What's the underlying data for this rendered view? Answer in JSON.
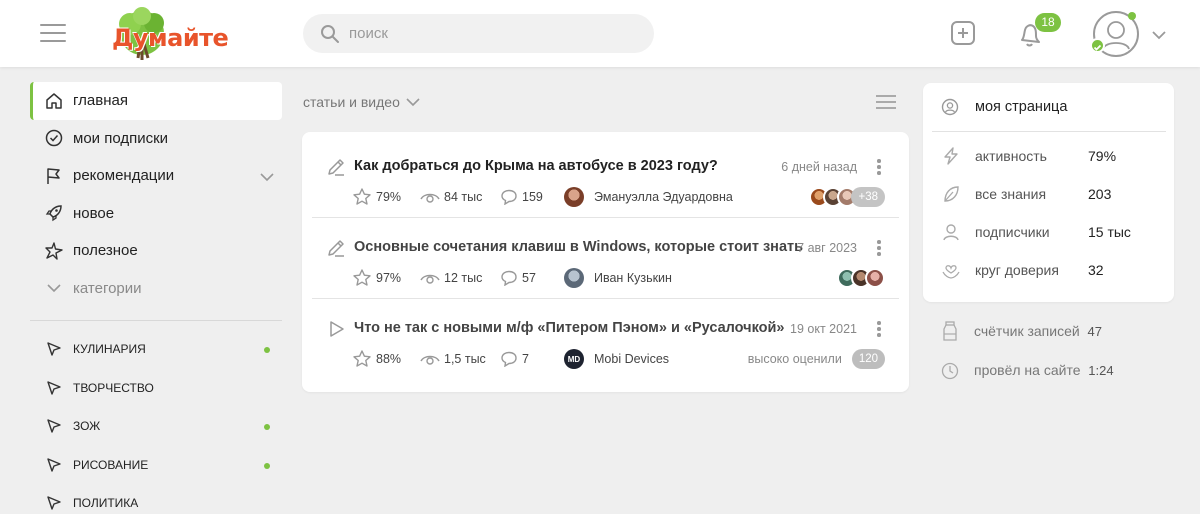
{
  "header": {
    "logo_text": "Думайте",
    "search_placeholder": "поиск",
    "notifications_count": "18"
  },
  "sidebar": {
    "items": [
      {
        "label": "главная",
        "icon": "home-icon",
        "active": true
      },
      {
        "label": "мои подписки",
        "icon": "check-circle-icon"
      },
      {
        "label": "рекомендации",
        "icon": "flag-icon"
      },
      {
        "label": "новое",
        "icon": "rocket-icon"
      },
      {
        "label": "полезное",
        "icon": "star-sparkle-icon"
      },
      {
        "label": "категории",
        "icon": "chevron-down-icon"
      }
    ],
    "categories": [
      {
        "label": "КУЛИНАРИЯ",
        "dot": true
      },
      {
        "label": "ТВОРЧЕСТВО",
        "dot": false
      },
      {
        "label": "ЗОЖ",
        "dot": true
      },
      {
        "label": "РИСОВАНИЕ",
        "dot": true
      },
      {
        "label": "ПОЛИТИКА",
        "dot": false
      }
    ]
  },
  "feed": {
    "filter_label": "статьи и видео",
    "posts": [
      {
        "type": "article",
        "title": "Как добраться до Крыма на автобусе в 2023 году?",
        "date": "6 дней назад",
        "rating": "79%",
        "views": "84 тыс",
        "comments": "159",
        "author": "Эмануэлла Эдуардовна",
        "extra_readers": "+38"
      },
      {
        "type": "article",
        "title": "Основные сочетания клавиш в Windows, которые стоит знать",
        "date": "7 авг 2023",
        "rating": "97%",
        "views": "12 тыс",
        "comments": "57",
        "author": "Иван Кузькин"
      },
      {
        "type": "video",
        "title": "Что не так с новыми м/ф  «Питером Пэном» и «Русалочкой»",
        "date": "19 окт 2021",
        "rating": "88%",
        "views": "1,5 тыс",
        "comments": "7",
        "author": "Mobi Devices",
        "author_initials": "MD",
        "rated_text": "высоко оценили",
        "rated_count": "120"
      }
    ]
  },
  "profile": {
    "my_page_label": "моя страница",
    "rows": [
      {
        "label": "активность",
        "value": "79%",
        "icon": "lightning-icon"
      },
      {
        "label": "все знания",
        "value": "203",
        "icon": "leaf-icon"
      },
      {
        "label": "подписчики",
        "value": "15 тыс",
        "icon": "user-icon"
      },
      {
        "label": "круг доверия",
        "value": "32",
        "icon": "heart-hands-icon"
      }
    ],
    "stats": [
      {
        "label": "счётчик записей",
        "value": "47",
        "icon": "bottle-icon"
      },
      {
        "label": "провёл на сайте",
        "value": "1:24",
        "icon": "clock-icon"
      }
    ]
  },
  "colors": {
    "accent": "#7dc242",
    "logo": "#e8542b",
    "background": "#efefef"
  }
}
